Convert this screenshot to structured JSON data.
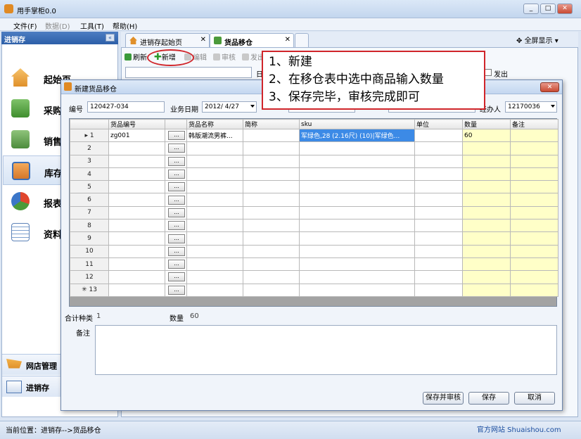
{
  "window": {
    "title": "用手掌柜0.0",
    "min": "_",
    "max": "□",
    "close": "✕"
  },
  "menu": [
    {
      "label": "文件(F)",
      "enabled": true
    },
    {
      "label": "数据(D)",
      "enabled": false
    },
    {
      "label": "工具(T)",
      "enabled": true
    },
    {
      "label": "帮助(H)",
      "enabled": true
    }
  ],
  "sidebar": {
    "header": "进销存",
    "items": [
      {
        "label": "起始页",
        "icon": "home-icon"
      },
      {
        "label": "采购",
        "icon": "purchase-icon"
      },
      {
        "label": "销售",
        "icon": "cart-icon"
      },
      {
        "label": "库存",
        "icon": "inventory-icon"
      },
      {
        "label": "报表",
        "icon": "pie-chart-icon"
      },
      {
        "label": "资料",
        "icon": "data-settings-icon"
      }
    ],
    "bottom": [
      {
        "label": "网店管理",
        "icon": "shop-cart-icon"
      },
      {
        "label": "进销存",
        "icon": "calendar-icon"
      }
    ]
  },
  "tabs": [
    {
      "label": "进销存起始页"
    },
    {
      "label": "货品移仓"
    }
  ],
  "fullscreen": "全屏显示",
  "toolbar": {
    "refresh": "刷新",
    "add": "新增",
    "edit": "编辑",
    "audit": "审核",
    "send": "发出",
    "filter_label": "日",
    "out_label": "发出"
  },
  "dialog": {
    "title": "新建货品移仓",
    "code_label": "编号",
    "code_value": "120427-034",
    "date_label": "业务日期",
    "date_value": "2012/ 4/27",
    "handler_label": "经办人",
    "handler_value": "12170036",
    "columns": [
      "货品编号",
      "货品名称",
      "简称",
      "sku",
      "单位",
      "数量",
      "备注"
    ],
    "rows": [
      {
        "no": "1",
        "code": "zg001",
        "name": "韩版潮流男裤...",
        "abbr": "",
        "sku": "军绿色,28 (2.16尺) (10)|军绿色...",
        "unit": "",
        "qty": "60",
        "note": ""
      },
      {
        "no": "2",
        "code": "",
        "name": "",
        "abbr": "",
        "sku": "",
        "unit": "",
        "qty": "",
        "note": ""
      },
      {
        "no": "3",
        "code": "",
        "name": "",
        "abbr": "",
        "sku": "",
        "unit": "",
        "qty": "",
        "note": ""
      },
      {
        "no": "4",
        "code": "",
        "name": "",
        "abbr": "",
        "sku": "",
        "unit": "",
        "qty": "",
        "note": ""
      },
      {
        "no": "5",
        "code": "",
        "name": "",
        "abbr": "",
        "sku": "",
        "unit": "",
        "qty": "",
        "note": ""
      },
      {
        "no": "6",
        "code": "",
        "name": "",
        "abbr": "",
        "sku": "",
        "unit": "",
        "qty": "",
        "note": ""
      },
      {
        "no": "7",
        "code": "",
        "name": "",
        "abbr": "",
        "sku": "",
        "unit": "",
        "qty": "",
        "note": ""
      },
      {
        "no": "8",
        "code": "",
        "name": "",
        "abbr": "",
        "sku": "",
        "unit": "",
        "qty": "",
        "note": ""
      },
      {
        "no": "9",
        "code": "",
        "name": "",
        "abbr": "",
        "sku": "",
        "unit": "",
        "qty": "",
        "note": ""
      },
      {
        "no": "10",
        "code": "",
        "name": "",
        "abbr": "",
        "sku": "",
        "unit": "",
        "qty": "",
        "note": ""
      },
      {
        "no": "11",
        "code": "",
        "name": "",
        "abbr": "",
        "sku": "",
        "unit": "",
        "qty": "",
        "note": ""
      },
      {
        "no": "12",
        "code": "",
        "name": "",
        "abbr": "",
        "sku": "",
        "unit": "",
        "qty": "",
        "note": ""
      },
      {
        "no": "13",
        "code": "",
        "name": "",
        "abbr": "",
        "sku": "",
        "unit": "",
        "qty": "",
        "note": ""
      }
    ],
    "ellipsis": "...",
    "total_kinds_label": "合计种类",
    "total_kinds_value": "1",
    "qty_label": "数量",
    "qty_value": "60",
    "remark_label": "备注",
    "save_audit": "保存并审核",
    "save": "保存",
    "cancel": "取消"
  },
  "callout": {
    "line1": "1、新建",
    "line2": "2、在移仓表中选中商品输入数量",
    "line3": "3、保存完毕，审核完成即可"
  },
  "status": {
    "location": "当前位置：进销存-->货品移仓",
    "site": "官方网站 Shuaishou.com"
  },
  "colors": {
    "accent": "#2d5fa8",
    "highlight": "#d0252a",
    "qty_column": "#ffffc8",
    "selected_cell": "#3c8ae6"
  }
}
